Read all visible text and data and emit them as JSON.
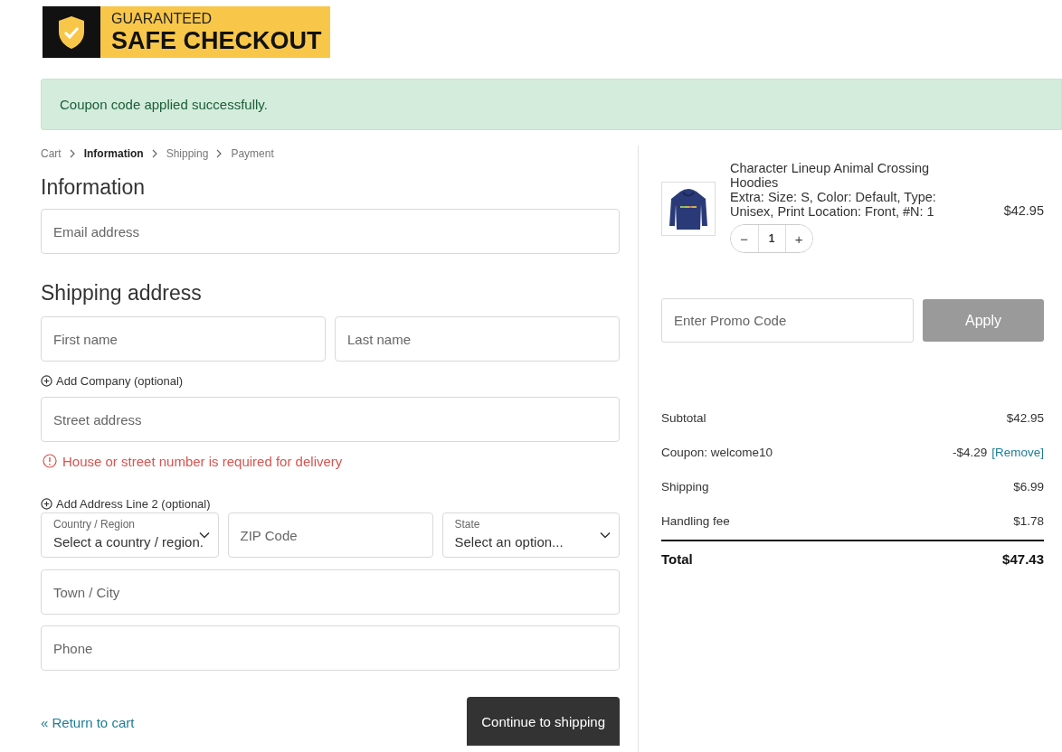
{
  "logo": {
    "top": "GUARANTEED",
    "bottom": "SAFE CHECKOUT"
  },
  "alert": "Coupon code applied successfully.",
  "breadcrumb": [
    {
      "label": "Cart",
      "selected": false
    },
    {
      "label": "Information",
      "selected": true
    },
    {
      "label": "Shipping",
      "selected": false
    },
    {
      "label": "Payment",
      "selected": false
    }
  ],
  "information": {
    "heading": "Information",
    "email": {
      "placeholder": "Email address"
    }
  },
  "shipping_address": {
    "heading": "Shipping address",
    "first_name": {
      "placeholder": "First name"
    },
    "last_name": {
      "placeholder": "Last name"
    },
    "add_company": "Add Company (optional)",
    "street": {
      "placeholder": "Street address"
    },
    "error": "House or street number is required for delivery",
    "add_line2": "Add Address Line 2 (optional)",
    "row": [
      {
        "kind": "select",
        "label": "Country / Region",
        "value": "Select a country / region."
      },
      {
        "kind": "input",
        "placeholder": "ZIP Code"
      },
      {
        "kind": "select",
        "label": "State",
        "value": "Select an option..."
      }
    ],
    "town": {
      "placeholder": "Town / City"
    },
    "phone": {
      "placeholder": "Phone"
    }
  },
  "return_link": "« Return to cart",
  "continue_button": "Continue to shipping",
  "product": {
    "name": "Character Lineup Animal Crossing Hoodies",
    "extra": "Extra: Size: S, Color: Default, Type: Unisex, Print Location: Front, #N: 1",
    "quantity": "1",
    "minus": "−",
    "plus": "+",
    "price": "$42.95"
  },
  "promo": {
    "placeholder": "Enter Promo Code",
    "button": "Apply"
  },
  "summary": [
    {
      "label": "Subtotal",
      "value": "$42.95"
    },
    {
      "label": "Coupon: welcome10",
      "value": "-$4.29",
      "link": "[Remove]"
    },
    {
      "label": "Shipping",
      "value": "$6.99"
    },
    {
      "label": "Handling fee",
      "value": "$1.78"
    }
  ],
  "total": {
    "label": "Total",
    "value": "$47.43"
  }
}
